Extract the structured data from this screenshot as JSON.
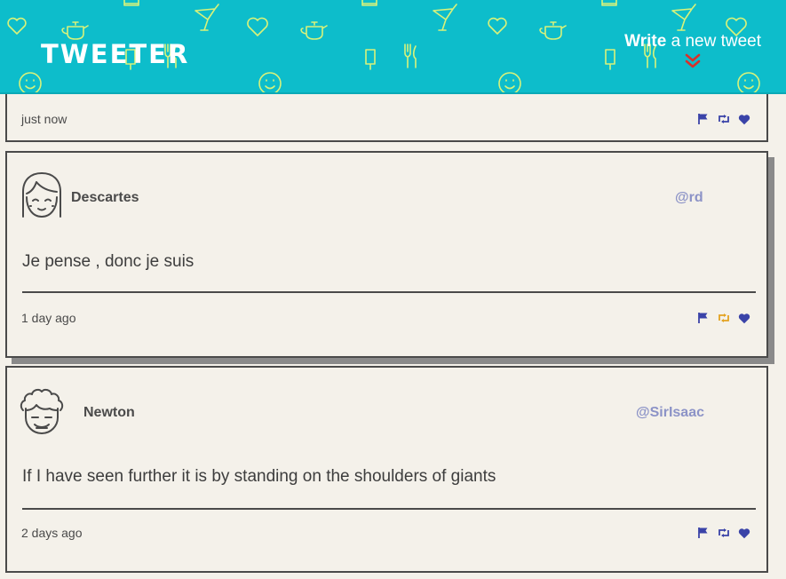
{
  "header": {
    "brand": "TWEETER",
    "compose_strong": "Write",
    "compose_rest": " a new tweet"
  },
  "colors": {
    "header_bg": "#0dbdcb",
    "pattern": "#d8f27a",
    "action_blue": "#3a43a8",
    "retweet_active": "#e3a321",
    "handle": "#8c93c7",
    "chevron": "#d8312b"
  },
  "tweets": [
    {
      "time": "just now",
      "actions": [
        "flag-icon",
        "retweet-icon",
        "heart-icon"
      ]
    },
    {
      "name": "Descartes",
      "handle": "@rd",
      "avatar": "girl-avatar-icon",
      "content": "Je pense , donc je suis",
      "time": "1 day ago",
      "retweeted": true,
      "actions": [
        "flag-icon",
        "retweet-icon",
        "heart-icon"
      ]
    },
    {
      "name": "Newton",
      "handle": "@SirIsaac",
      "avatar": "curly-hair-avatar-icon",
      "content": "If I have seen further it is by standing on the shoulders of giants",
      "time": "2 days ago",
      "retweeted": false,
      "actions": [
        "flag-icon",
        "retweet-icon",
        "heart-icon"
      ]
    }
  ]
}
